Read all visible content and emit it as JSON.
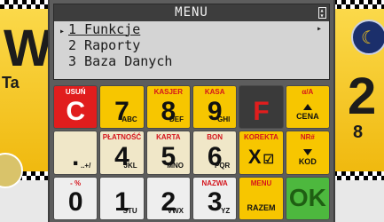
{
  "background": {
    "big_letter": "W",
    "small_text": "Ta",
    "right_big": "2",
    "right_small": "8",
    "moon_icon": "moon-icon",
    "accent_color": "#f5c419"
  },
  "lcd": {
    "title": "MENU",
    "rows": [
      {
        "marker": "▸",
        "label": "1 Funkcje",
        "arrow": "▸"
      },
      {
        "marker": "",
        "label": "2 Raporty",
        "arrow": ""
      },
      {
        "marker": "",
        "label": "3 Baza Danych",
        "arrow": ""
      }
    ]
  },
  "keypad": {
    "row1": [
      {
        "top": "USUŃ",
        "main": "C",
        "sub": ""
      },
      {
        "top": "",
        "main": "7",
        "sub": "ABC"
      },
      {
        "top": "KASJER",
        "main": "8",
        "sub": "DEF"
      },
      {
        "top": "KASA",
        "main": "9",
        "sub": "GHI"
      },
      {
        "top": "",
        "main": "F",
        "sub": ""
      },
      {
        "top": "α/A",
        "main": "",
        "sub": "CENA"
      }
    ],
    "row2": [
      {
        "top": "",
        "main": ".",
        "sub": "..+/"
      },
      {
        "top": "PŁATNOŚĆ",
        "main": "4",
        "sub": "JKL"
      },
      {
        "top": "KARTA",
        "main": "5",
        "sub": "MNO"
      },
      {
        "top": "BON",
        "main": "6",
        "sub": "PQR"
      },
      {
        "top": "KOREKTA",
        "main": "X",
        "sub": ""
      },
      {
        "top": "NR#",
        "main": "",
        "sub": "KOD"
      }
    ],
    "row3": [
      {
        "top": "- %",
        "main": "0",
        "sub": ""
      },
      {
        "top": "",
        "main": "1",
        "sub": "STU"
      },
      {
        "top": "",
        "main": "2",
        "sub": "VWX"
      },
      {
        "top": "NAZWA",
        "main": "3",
        "sub": "YZ"
      },
      {
        "top": "MENU",
        "main": "",
        "sub": "RAZEM"
      },
      {
        "top": "",
        "main": "OK",
        "sub": ""
      }
    ]
  }
}
